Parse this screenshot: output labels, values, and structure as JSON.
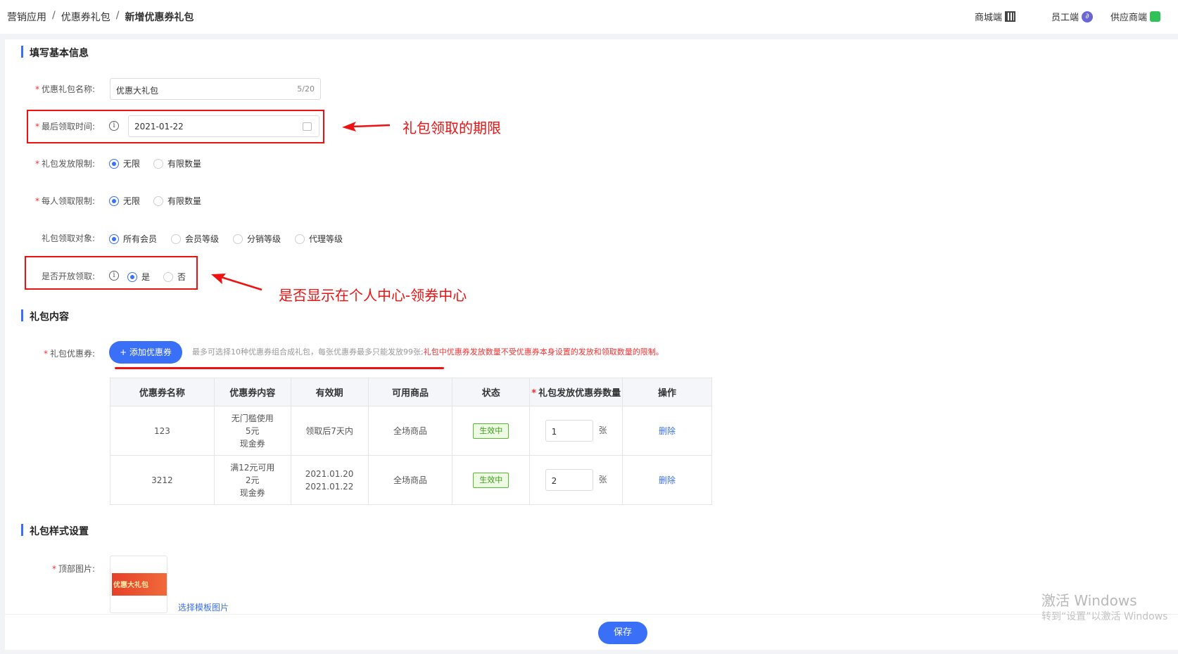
{
  "breadcrumb": {
    "items": [
      "营销应用",
      "优惠券礼包",
      "新增优惠券礼包"
    ]
  },
  "portals": {
    "mall": "商城端",
    "staff": "员工端",
    "supplier": "供应商端"
  },
  "sections": {
    "basic": "填写基本信息",
    "content": "礼包内容",
    "style": "礼包样式设置"
  },
  "form": {
    "name_label": "优惠礼包名称:",
    "name_value": "优惠大礼包",
    "name_count": "5/20",
    "deadline_label": "最后领取时间:",
    "deadline_value": "2021-01-22",
    "issue_limit_label": "礼包发放限制:",
    "issue_limit_options": [
      "无限",
      "有限数量"
    ],
    "per_person_label": "每人领取限制:",
    "per_person_options": [
      "无限",
      "有限数量"
    ],
    "target_label": "礼包领取对象:",
    "target_options": [
      "所有会员",
      "会员等级",
      "分销等级",
      "代理等级"
    ],
    "open_label": "是否开放领取:",
    "open_options": [
      "是",
      "否"
    ],
    "coupon_label": "礼包优惠券:",
    "add_coupon_button": "+ 添加优惠券",
    "hint_normal": "最多可选择10种优惠券组合成礼包，每张优惠券最多只能发放99张;",
    "hint_warn": "礼包中优惠券发放数量不受优惠券本身设置的发放和领取数量的限制。",
    "top_image_label": "顶部图片:",
    "choose_template": "选择模板图片"
  },
  "annotations": {
    "deadline_note": "礼包领取的期限",
    "open_note": "是否显示在个人中心-领券中心"
  },
  "table": {
    "headers": [
      "优惠券名称",
      "优惠券内容",
      "有效期",
      "可用商品",
      "状态",
      "礼包发放优惠券数量",
      "操作"
    ],
    "rows": [
      {
        "name": "123",
        "content": [
          "无门槛使用",
          "5元",
          "现金券"
        ],
        "validity": [
          "领取后7天内"
        ],
        "goods": "全场商品",
        "status": "生效中",
        "qty": "1",
        "unit": "张",
        "action": "删除"
      },
      {
        "name": "3212",
        "content": [
          "满12元可用",
          "2元",
          "现金券"
        ],
        "validity": [
          "2021.01.20",
          "2021.01.22"
        ],
        "goods": "全场商品",
        "status": "生效中",
        "qty": "2",
        "unit": "张",
        "action": "删除"
      }
    ]
  },
  "thumbnail_text": "优惠大礼包",
  "save_button": "保存",
  "watermark": {
    "line1": "激活 Windows",
    "line2": "转到“设置”以激活 Windows"
  },
  "colors": {
    "primary": "#3a6ff7",
    "annotation_red": "#e11111",
    "status_green": "#3a9d12"
  }
}
